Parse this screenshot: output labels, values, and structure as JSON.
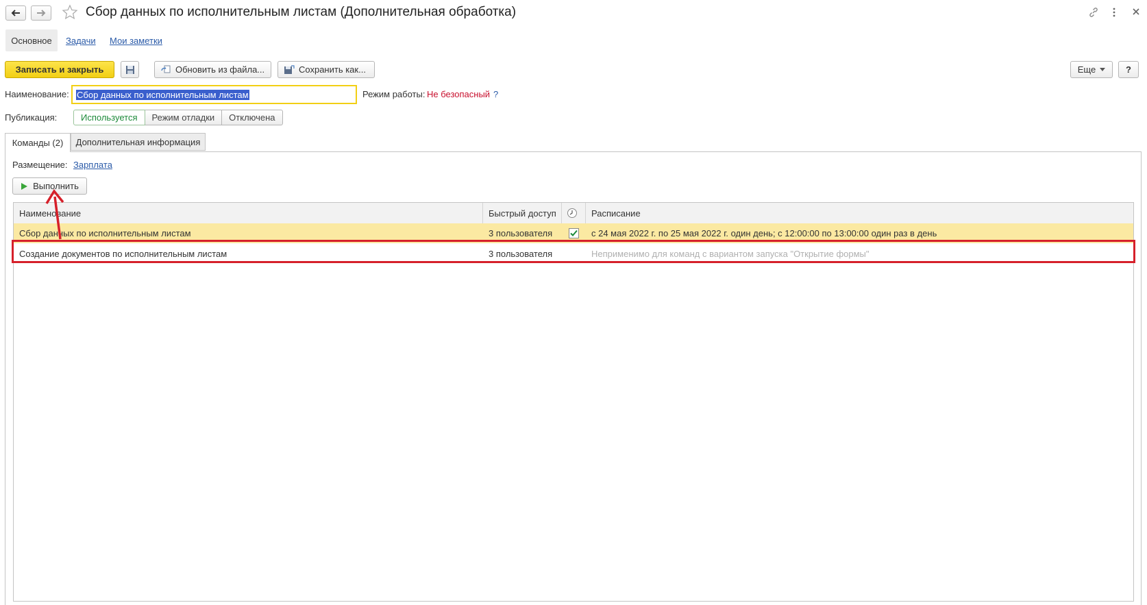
{
  "header": {
    "title": "Сбор данных по исполнительным листам (Дополнительная обработка)"
  },
  "section_tabs": [
    {
      "label": "Основное",
      "active": true
    },
    {
      "label": "Задачи",
      "active": false
    },
    {
      "label": "Мои заметки",
      "active": false
    }
  ],
  "toolbar": {
    "save_close": "Записать и закрыть",
    "update_from_file": "Обновить из файла...",
    "save_as": "Сохранить как...",
    "more": "Еще",
    "help": "?"
  },
  "form": {
    "name_label": "Наименование:",
    "name_value": "Сбор данных по исполнительным листам",
    "mode_label": "Режим работы:",
    "mode_value": "Не безопасный",
    "mode_help": "?",
    "publication_label": "Публикация:",
    "publication_options": [
      "Используется",
      "Режим отладки",
      "Отключена"
    ],
    "publication_selected": "Используется"
  },
  "inner_tabs": [
    {
      "label": "Команды (2)",
      "active": true
    },
    {
      "label": "Дополнительная информация",
      "active": false
    }
  ],
  "commands": {
    "placement_label": "Размещение:",
    "placement_value": "Зарплата",
    "run_button": "Выполнить",
    "columns": [
      "Наименование",
      "Быстрый доступ",
      "",
      "Расписание"
    ],
    "rows": [
      {
        "name": "Сбор данных по исполнительным листам",
        "quick_access": "3 пользователя",
        "scheduled": true,
        "schedule": "с 24 мая 2022 г. по 25 мая 2022 г. один день; с 12:00:00 по 13:00:00 один раз в день"
      },
      {
        "name": "Создание документов по исполнительным листам",
        "quick_access": "3 пользователя",
        "scheduled": false,
        "schedule": "Неприменимо для команд с вариантом запуска \"Открытие формы\""
      }
    ]
  },
  "colors": {
    "accent_yellow": "#f7d92a",
    "highlight_row": "#fbe9a2",
    "annotation_red": "#d6202a",
    "mode_red": "#c8102e",
    "link_blue": "#2a5aa8"
  }
}
